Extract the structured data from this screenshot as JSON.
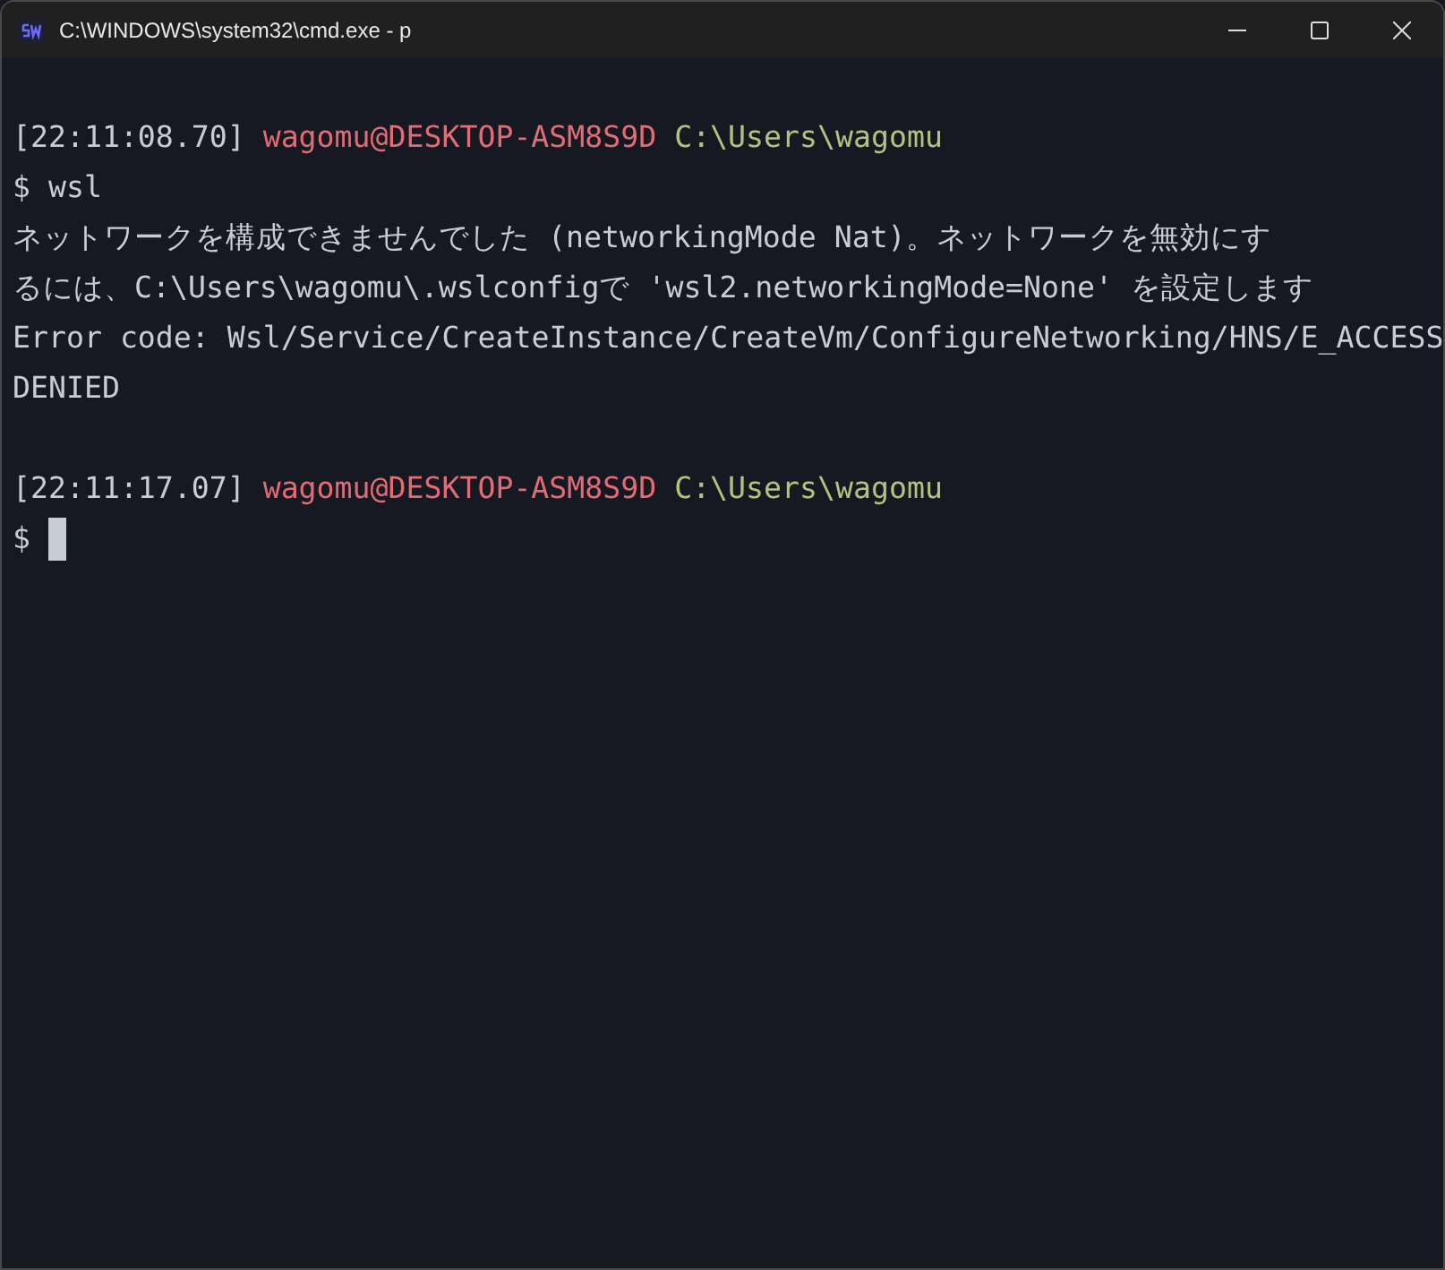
{
  "window": {
    "title": "C:\\WINDOWS\\system32\\cmd.exe - p"
  },
  "terminal": {
    "blocks": [
      {
        "lines": [
          {
            "segments": [
              {
                "kind": "plain",
                "text": "[22:11:08.70]"
              },
              {
                "kind": "user",
                "text": "wagomu@DESKTOP-ASM8S9D"
              },
              {
                "kind": "path",
                "text": "C:\\Users\\wagomu"
              }
            ]
          },
          {
            "segments": [
              {
                "kind": "plain",
                "text": "$ wsl"
              }
            ]
          },
          {
            "segments": [
              {
                "kind": "plain",
                "text": "ネットワークを構成できませんでした (networkingMode Nat)。ネットワークを無効にす"
              }
            ]
          },
          {
            "segments": [
              {
                "kind": "plain",
                "text": "るには、C:\\Users\\wagomu\\.wslconfigで 'wsl2.networkingMode=None' を設定します"
              }
            ]
          },
          {
            "segments": [
              {
                "kind": "plain",
                "text": "Error code: Wsl/Service/CreateInstance/CreateVm/ConfigureNetworking/HNS/E_ACCESS"
              }
            ]
          },
          {
            "segments": [
              {
                "kind": "plain",
                "text": "DENIED"
              }
            ]
          }
        ]
      },
      {
        "lines": [
          {
            "segments": [
              {
                "kind": "plain",
                "text": "[22:11:17.07]"
              },
              {
                "kind": "user",
                "text": "wagomu@DESKTOP-ASM8S9D"
              },
              {
                "kind": "path",
                "text": "C:\\Users\\wagomu"
              }
            ]
          },
          {
            "segments": [
              {
                "kind": "plain",
                "text": "$"
              },
              {
                "kind": "cursor"
              }
            ]
          }
        ]
      }
    ]
  }
}
